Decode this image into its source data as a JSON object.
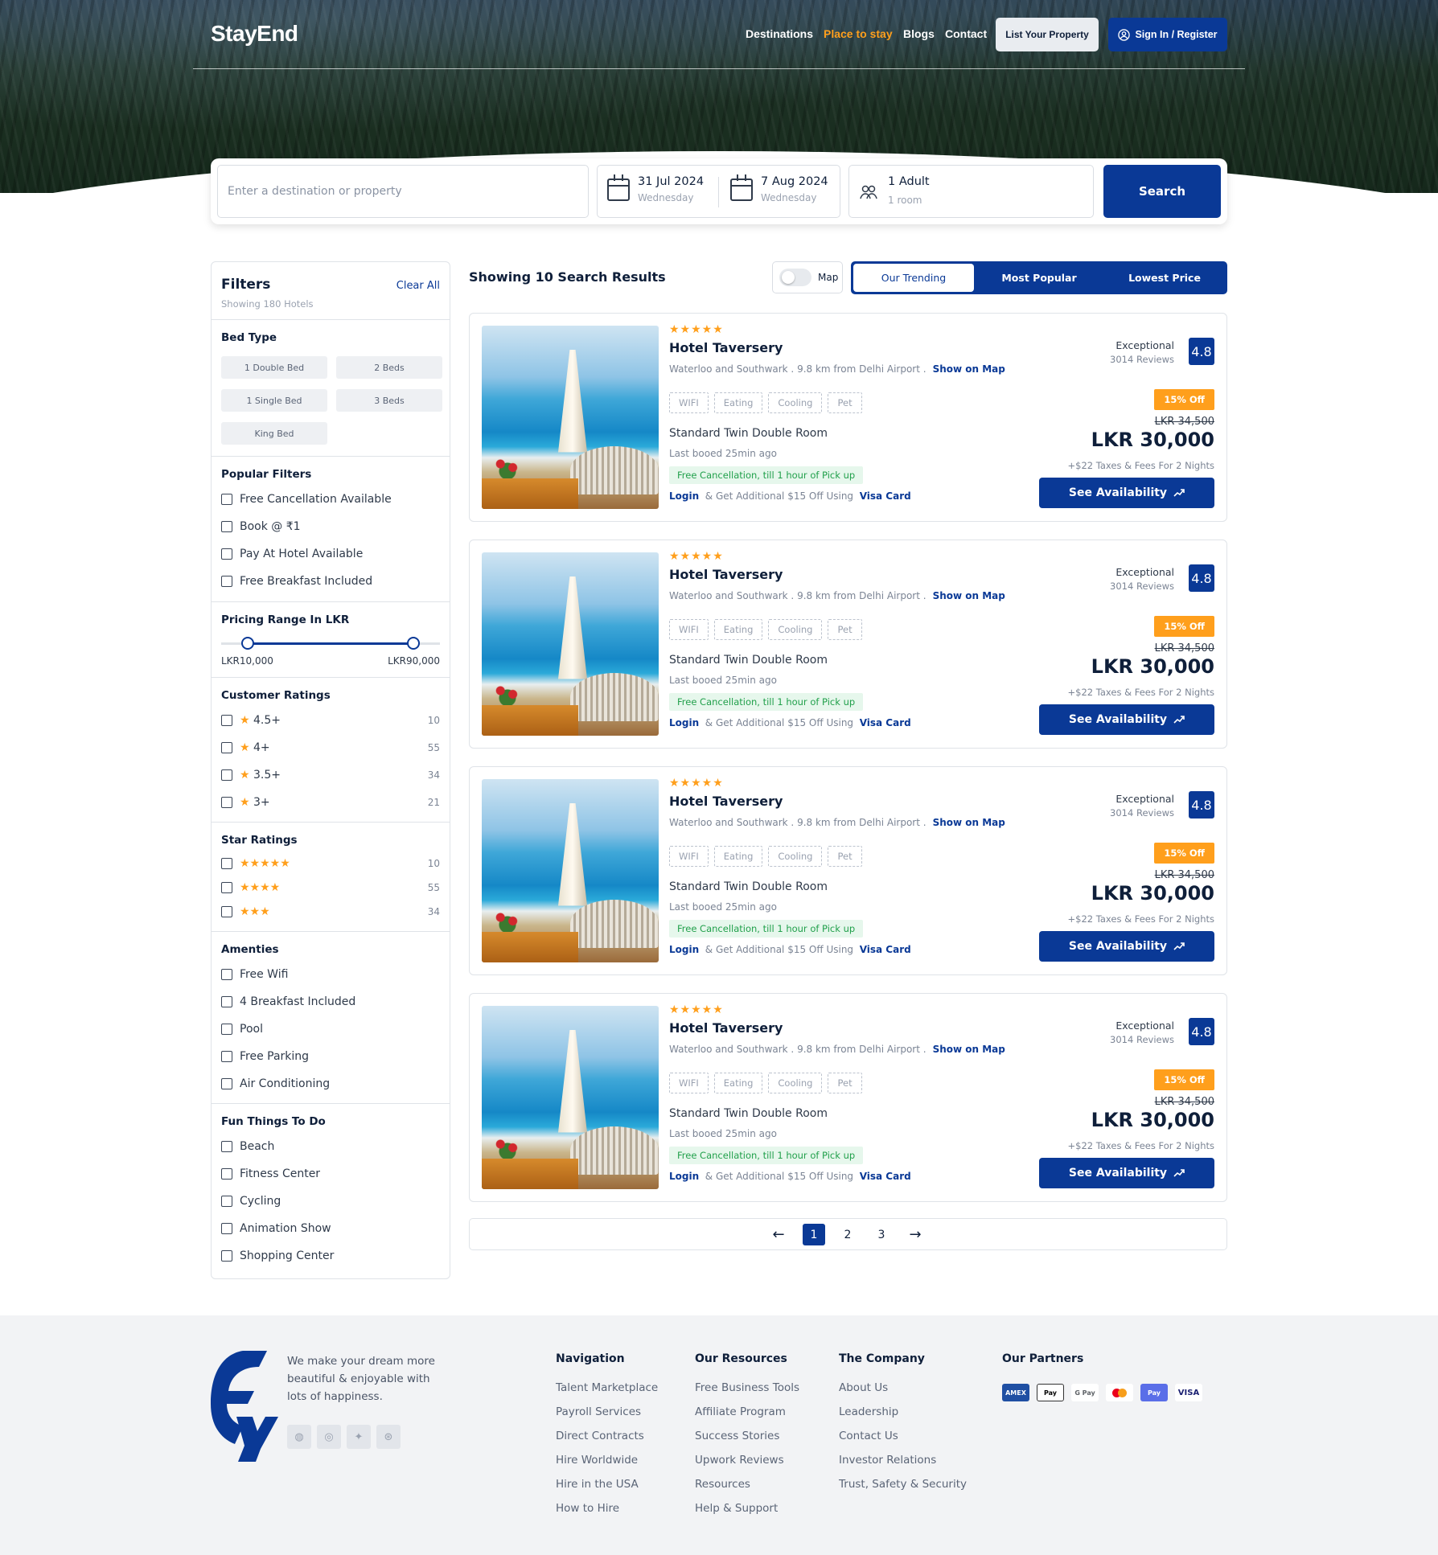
{
  "brand": {
    "name": "StayEnd"
  },
  "nav": {
    "items": [
      "Destinations",
      "Place to stay",
      "Blogs",
      "Contact"
    ],
    "list_property": "List Your Property",
    "sign_in": "Sign In / Register"
  },
  "search": {
    "placeholder": "Enter a destination or property",
    "checkin_date": "31 Jul 2024",
    "checkin_day": "Wednesday",
    "checkout_date": "7 Aug 2024",
    "checkout_day": "Wednesday",
    "guests": "1 Adult",
    "rooms": "1 room",
    "button": "Search"
  },
  "filters": {
    "title": "Filters",
    "clear": "Clear All",
    "subtitle": "Showing 180 Hotels",
    "bed_type": {
      "title": "Bed Type",
      "options": [
        "1 Double Bed",
        "2 Beds",
        "1 Single Bed",
        "3 Beds",
        "King Bed"
      ]
    },
    "popular": {
      "title": "Popular Filters",
      "options": [
        "Free Cancellation Available",
        "Book @ ₹1",
        "Pay At Hotel Available",
        "Free Breakfast Included"
      ]
    },
    "pricing": {
      "title": "Pricing Range In LKR",
      "min_label": "LKR10,000",
      "max_label": "LKR90,000",
      "low_fraction": 0.12,
      "high_fraction": 0.88
    },
    "customer_ratings": {
      "title": "Customer Ratings",
      "items": [
        {
          "label": "4.5+",
          "count": "10"
        },
        {
          "label": "4+",
          "count": "55"
        },
        {
          "label": "3.5+",
          "count": "34"
        },
        {
          "label": "3+",
          "count": "21"
        }
      ]
    },
    "star_ratings": {
      "title": "Star Ratings",
      "items": [
        {
          "stars": 5,
          "count": "10"
        },
        {
          "stars": 4,
          "count": "55"
        },
        {
          "stars": 3,
          "count": "34"
        }
      ]
    },
    "amenities": {
      "title": "Amenties",
      "options": [
        "Free Wifi",
        "4 Breakfast Included",
        "Pool",
        "Free Parking",
        "Air Conditioning"
      ]
    },
    "fun": {
      "title": "Fun Things To Do",
      "options": [
        "Beach",
        "Fitness Center",
        "Cycling",
        "Animation Show",
        "Shopping Center"
      ]
    }
  },
  "results": {
    "title": "Showing 10 Search Results",
    "map_label": "Map",
    "sort": [
      "Our Trending",
      "Most Popular",
      "Lowest Price"
    ]
  },
  "hotels": [
    {
      "rating_stars": "★★★★★",
      "name": "Hotel Taversery",
      "location": "Waterloo and Southwark . 9.8 km from Delhi Airport .",
      "map_link": "Show on Map",
      "tags": [
        "WIFI",
        "Eating",
        "Cooling",
        "Pet"
      ],
      "room": "Standard Twin Double Room",
      "last": "Last booed 25min ago",
      "free": "Free Cancellation, till 1 hour of Pick up",
      "login": "Login",
      "login_text": "& Get Additional $15 Off Using",
      "card": "Visa Card",
      "review_label": "Exceptional",
      "reviews": "3014 Reviews",
      "score": "4.8",
      "discount": "15% Off",
      "old_price": "LKR 34,500",
      "price": "LKR 30,000",
      "tax": "+$22 Taxes & Fees For 2 Nights",
      "button": "See Availability"
    },
    {
      "rating_stars": "★★★★★",
      "name": "Hotel Taversery",
      "location": "Waterloo and Southwark . 9.8 km from Delhi Airport .",
      "map_link": "Show on Map",
      "tags": [
        "WIFI",
        "Eating",
        "Cooling",
        "Pet"
      ],
      "room": "Standard Twin Double Room",
      "last": "Last booed 25min ago",
      "free": "Free Cancellation, till 1 hour of Pick up",
      "login": "Login",
      "login_text": "& Get Additional $15 Off Using",
      "card": "Visa Card",
      "review_label": "Exceptional",
      "reviews": "3014 Reviews",
      "score": "4.8",
      "discount": "15% Off",
      "old_price": "LKR 34,500",
      "price": "LKR 30,000",
      "tax": "+$22 Taxes & Fees For 2 Nights",
      "button": "See Availability"
    },
    {
      "rating_stars": "★★★★★",
      "name": "Hotel Taversery",
      "location": "Waterloo and Southwark . 9.8 km from Delhi Airport .",
      "map_link": "Show on Map",
      "tags": [
        "WIFI",
        "Eating",
        "Cooling",
        "Pet"
      ],
      "room": "Standard Twin Double Room",
      "last": "Last booed 25min ago",
      "free": "Free Cancellation, till 1 hour of Pick up",
      "login": "Login",
      "login_text": "& Get Additional $15 Off Using",
      "card": "Visa Card",
      "review_label": "Exceptional",
      "reviews": "3014 Reviews",
      "score": "4.8",
      "discount": "15% Off",
      "old_price": "LKR 34,500",
      "price": "LKR 30,000",
      "tax": "+$22 Taxes & Fees For 2 Nights",
      "button": "See Availability"
    },
    {
      "rating_stars": "★★★★★",
      "name": "Hotel Taversery",
      "location": "Waterloo and Southwark . 9.8 km from Delhi Airport .",
      "map_link": "Show on Map",
      "tags": [
        "WIFI",
        "Eating",
        "Cooling",
        "Pet"
      ],
      "room": "Standard Twin Double Room",
      "last": "Last booed 25min ago",
      "free": "Free Cancellation, till 1 hour of Pick up",
      "login": "Login",
      "login_text": "& Get Additional $15 Off Using",
      "card": "Visa Card",
      "review_label": "Exceptional",
      "reviews": "3014 Reviews",
      "score": "4.8",
      "discount": "15% Off",
      "old_price": "LKR 34,500",
      "price": "LKR 30,000",
      "tax": "+$22 Taxes & Fees For 2 Nights",
      "button": "See Availability"
    }
  ],
  "pagination": {
    "prev": "←",
    "pages": [
      "1",
      "2",
      "3"
    ],
    "current": "1",
    "next": "→"
  },
  "footer": {
    "tagline": "We make your dream more beautiful & enjoyable with lots of happiness.",
    "social_icons": [
      "dribbble-icon",
      "instagram-icon",
      "twitter-icon",
      "web-icon"
    ],
    "columns": [
      {
        "title": "Navigation",
        "links": [
          "Talent Marketplace",
          "Payroll Services",
          "Direct Contracts",
          "Hire Worldwide",
          "Hire in the USA",
          "How to Hire"
        ]
      },
      {
        "title": "Our Resources",
        "links": [
          "Free Business Tools",
          "Affiliate Program",
          "Success Stories",
          "Upwork Reviews",
          "Resources",
          "Help & Support"
        ]
      },
      {
        "title": "The Company",
        "links": [
          "About Us",
          "Leadership",
          "Contact Us",
          "Investor Relations",
          "Trust, Safety & Security"
        ]
      }
    ],
    "partners_title": "Our Partners",
    "partners": [
      "AMEX",
      "Pay",
      "G Pay",
      "",
      "Pay",
      "VISA"
    ]
  },
  "colors": {
    "primary": "#0a3996",
    "accent": "#ff9f1c",
    "success": "#21a04b"
  }
}
